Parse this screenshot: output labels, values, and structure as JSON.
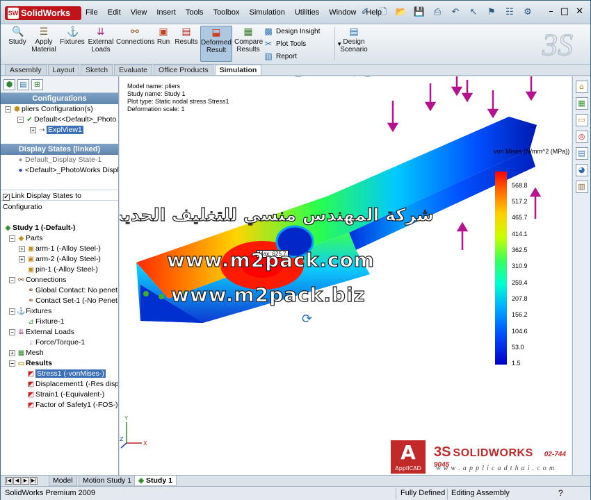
{
  "app": {
    "logo_text": "SolidWorks",
    "logo_badge": "SW",
    "menu": [
      "File",
      "Edit",
      "View",
      "Insert",
      "Tools",
      "Toolbox",
      "Simulation",
      "Utilities",
      "Window",
      "Help"
    ],
    "window_controls": [
      "–",
      "□",
      "✕"
    ]
  },
  "ribbon": {
    "buttons": [
      {
        "label1": "Study",
        "label2": "",
        "icon": "study-icon"
      },
      {
        "label1": "Apply",
        "label2": "Material",
        "icon": "material-icon"
      },
      {
        "label1": "Fixtures",
        "label2": "",
        "icon": "fixtures-icon"
      },
      {
        "label1": "External",
        "label2": "Loads",
        "icon": "loads-icon"
      },
      {
        "label1": "Connections",
        "label2": "",
        "icon": "connections-icon"
      },
      {
        "label1": "Run",
        "label2": "",
        "icon": "run-icon"
      },
      {
        "label1": "Results",
        "label2": "",
        "icon": "results-icon"
      },
      {
        "label1": "Deformed",
        "label2": "Result",
        "icon": "deformed-icon"
      },
      {
        "label1": "Compare",
        "label2": "Results",
        "icon": "compare-icon"
      }
    ],
    "small_buttons": [
      "Design Insight",
      "Plot Tools",
      "Report"
    ],
    "design_scenario": {
      "label1": "Design",
      "label2": "Scenario"
    }
  },
  "tabs": [
    "Assembly",
    "Layout",
    "Sketch",
    "Evaluate",
    "Office Products",
    "Simulation"
  ],
  "active_tab": "Simulation",
  "left_panel": {
    "configurations_title": "Configurations",
    "config_items": [
      "pliers Configuration(s)",
      "Default<<Default>_Photo",
      "ExplView1"
    ],
    "display_states_title": "Display States (linked)",
    "display_states": [
      "Default_Display State-1",
      "<Default>_PhotoWorks Displ"
    ],
    "link_label": "Link Display States to Configuratio",
    "study_tree": {
      "study": "Study 1 (-Default-)",
      "parts": "Parts",
      "part_items": [
        "arm-1 (-Alloy Steel-)",
        "arm-2 (-Alloy Steel-)",
        "pin-1 (-Alloy Steel-)"
      ],
      "connections": "Connections",
      "connection_items": [
        "Global Contact: No penet",
        "Contact Set-1 (-No Penet"
      ],
      "fixtures": "Fixtures",
      "fixture_items": [
        "Fixture-1"
      ],
      "external_loads": "External Loads",
      "load_items": [
        "Force/Torque-1"
      ],
      "mesh": "Mesh",
      "results": "Results",
      "result_items": [
        "Stress1 (-vonMises-)",
        "Displacement1 (-Res disp-",
        "Strain1 (-Equivalent-)",
        "Factor of Safety1 (-FOS-)"
      ]
    }
  },
  "viewport": {
    "info": [
      "Model name: pliers",
      "Study name: Study 1",
      "Plot type: Static nodal stress Stress1",
      "Deformation scale: 1"
    ],
    "legend_title": "von Mises (N/mm^2 (MPa))",
    "legend_values": [
      "568.8",
      "517.2",
      "465.7",
      "414.1",
      "362.5",
      "310.9",
      "259.4",
      "207.8",
      "156.2",
      "104.6",
      "53.0",
      "1.5"
    ],
    "max_label": "Max: 625.7",
    "watermark_arabic": "شركة المهندس منسي للتغليف الحديث",
    "watermark_url1": "www.m2pack.com",
    "watermark_url2": "www.m2pack.biz",
    "applicad_logo": "ApplICAD",
    "brand_ds": "3S",
    "brand_name": "SOLIDWORKS",
    "brand_phone": "02-744 9045",
    "brand_url": "w w w . a p p l i c a d t h a i . c o m"
  },
  "bottom": {
    "tabs": [
      "Model",
      "Motion Study 1",
      "Study 1"
    ],
    "active_tab": "Study 1"
  },
  "status": {
    "app_version": "SolidWorks Premium 2009",
    "state": "Fully Defined",
    "mode": "Editing Assembly",
    "help_icon": "?"
  },
  "colors": {
    "window_bg": "#d6dfe8",
    "selection": "#3b6fb6",
    "section_header": "#6f95bb",
    "accent_red": "#c22a2a"
  }
}
